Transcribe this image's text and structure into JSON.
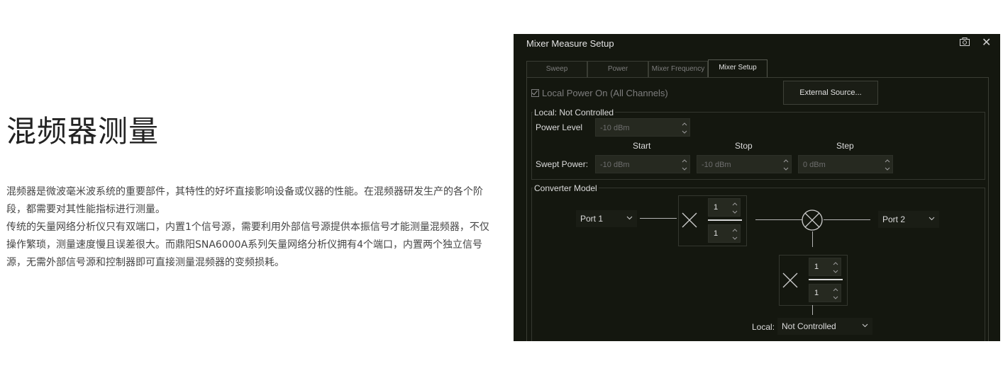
{
  "page": {
    "title": "混频器测量",
    "paragraphs": [
      "混频器是微波毫米波系统的重要部件，其特性的好坏直接影响设备或仪器的性能。在混频器研发生产的各个阶段，都需要对其性能指标进行测量。",
      "传统的矢量网络分析仪只有双端口，内置1个信号源，需要利用外部信号源提供本振信号才能测量混频器，不仅操作繁琐，测量速度慢且误差很大。而鼎阳SNA6000A系列矢量网络分析仪拥有4个端口，内置两个独立信号源，无需外部信号源和控制器即可直接测量混频器的变频损耗。"
    ]
  },
  "dialog": {
    "title": "Mixer Measure Setup",
    "icons": [
      "camera-icon",
      "close-icon"
    ],
    "close_glyph": "✕",
    "tabs": [
      "Sweep",
      "Power",
      "Mixer Frequency",
      "Mixer Setup"
    ],
    "active_tab": "Mixer Setup",
    "local_power_checkbox": "Local Power On (All Channels)",
    "local_power_checked": true,
    "external_source_button": "External Source...",
    "local_group": {
      "title": "Local: Not Controlled",
      "power_level_label": "Power Level",
      "power_level_value": "-10 dBm",
      "col_start": "Start",
      "col_stop": "Stop",
      "col_step": "Step",
      "swept_power_label": "Swept Power:",
      "swept_start": "-10 dBm",
      "swept_stop": "-10 dBm",
      "swept_step": "0 dBm"
    },
    "converter": {
      "title": "Converter Model",
      "input_port": "Port 1",
      "output_port": "Port 2",
      "input_numerator": "1",
      "input_denominator": "1",
      "local_numerator": "1",
      "local_denominator": "1",
      "local_label": "Local:",
      "local_value": "Not Controlled"
    }
  },
  "colors": {
    "dialog_bg": "#14170f",
    "field_bg": "#262920",
    "text_light": "#dcdcdc",
    "text_disabled": "#6e6e6e"
  }
}
